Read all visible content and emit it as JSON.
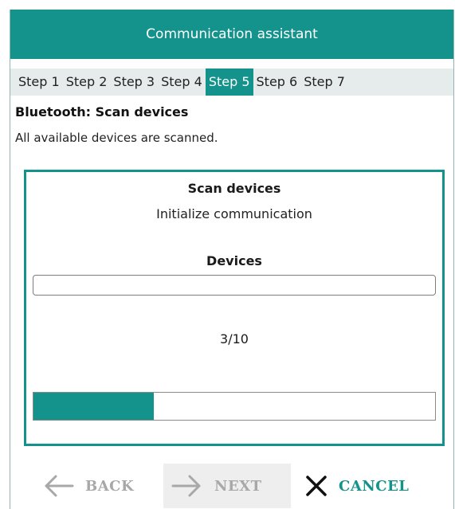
{
  "window": {
    "title": "Communication assistant"
  },
  "steps": [
    {
      "label": "Step 1",
      "active": false
    },
    {
      "label": "Step 2",
      "active": false
    },
    {
      "label": "Step 3",
      "active": false
    },
    {
      "label": "Step 4",
      "active": false
    },
    {
      "label": "Step 5",
      "active": true
    },
    {
      "label": "Step 6",
      "active": false
    },
    {
      "label": "Step 7",
      "active": false
    }
  ],
  "page": {
    "heading": "Bluetooth: Scan devices",
    "description": "All available devices are scanned."
  },
  "panel": {
    "title": "Scan devices",
    "subtitle": "Initialize communication",
    "devices_label": "Devices",
    "devices_value": "",
    "counter": "3/10",
    "progress_fraction": 0.3
  },
  "footer": {
    "back_label": "BACK",
    "next_label": "NEXT",
    "cancel_label": "CANCEL",
    "back_icon": "arrow-left-icon",
    "next_icon": "arrow-right-icon",
    "cancel_icon": "close-icon"
  },
  "colors": {
    "accent": "#14928c",
    "disabled_text": "#a8a8a8",
    "step_bar_bg": "#e6ebec"
  }
}
